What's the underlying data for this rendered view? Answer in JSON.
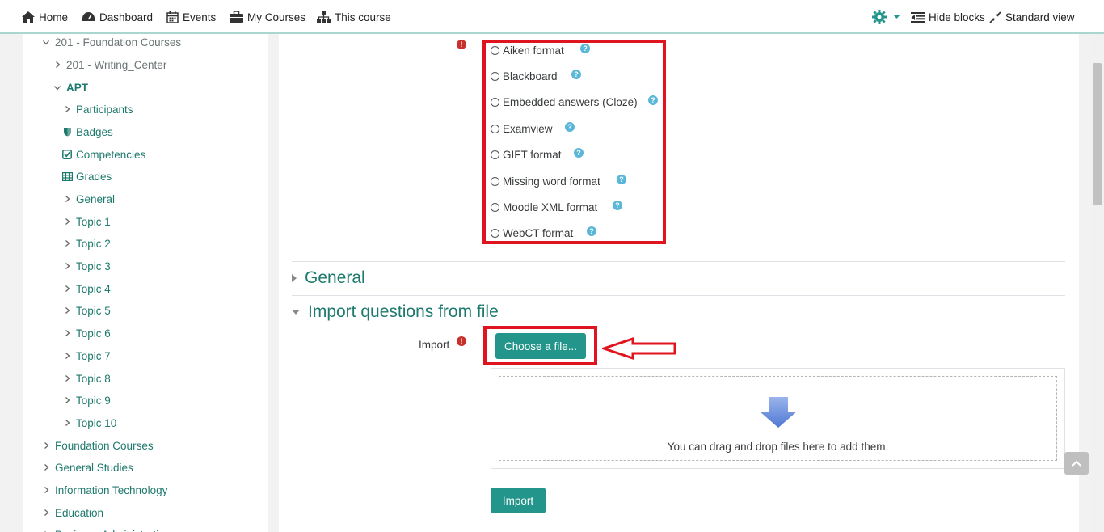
{
  "navbar": {
    "home": "Home",
    "dashboard": "Dashboard",
    "events": "Events",
    "my_courses": "My Courses",
    "this_course": "This course",
    "hide_blocks": "Hide blocks",
    "standard_view": "Standard view"
  },
  "sidebar": {
    "items": [
      {
        "label": "201 - Foundation Courses",
        "icon": "chevron-down"
      },
      {
        "label": "201 - Writing_Center",
        "icon": "chevron-right"
      },
      {
        "label": "APT",
        "icon": "chevron-down"
      },
      {
        "label": "Participants",
        "icon": "chevron-right"
      },
      {
        "label": "Badges",
        "icon": "shield"
      },
      {
        "label": "Competencies",
        "icon": "check-square"
      },
      {
        "label": "Grades",
        "icon": "table"
      },
      {
        "label": "General",
        "icon": "chevron-right"
      },
      {
        "label": "Topic 1",
        "icon": "chevron-right"
      },
      {
        "label": "Topic 2",
        "icon": "chevron-right"
      },
      {
        "label": "Topic 3",
        "icon": "chevron-right"
      },
      {
        "label": "Topic 4",
        "icon": "chevron-right"
      },
      {
        "label": "Topic 5",
        "icon": "chevron-right"
      },
      {
        "label": "Topic 6",
        "icon": "chevron-right"
      },
      {
        "label": "Topic 7",
        "icon": "chevron-right"
      },
      {
        "label": "Topic 8",
        "icon": "chevron-right"
      },
      {
        "label": "Topic 9",
        "icon": "chevron-right"
      },
      {
        "label": "Topic 10",
        "icon": "chevron-right"
      },
      {
        "label": "Foundation Courses",
        "icon": "chevron-right"
      },
      {
        "label": "General Studies",
        "icon": "chevron-right"
      },
      {
        "label": "Information Technology",
        "icon": "chevron-right"
      },
      {
        "label": "Education",
        "icon": "chevron-right"
      },
      {
        "label": "Business Administration",
        "icon": "chevron-right"
      }
    ]
  },
  "formats": [
    {
      "label": "Aiken format"
    },
    {
      "label": "Blackboard"
    },
    {
      "label": "Embedded answers (Cloze)"
    },
    {
      "label": "Examview"
    },
    {
      "label": "GIFT format"
    },
    {
      "label": "Missing word format"
    },
    {
      "label": "Moodle XML format"
    },
    {
      "label": "WebCT format"
    }
  ],
  "sections": {
    "general": "General",
    "import_from_file": "Import questions from file"
  },
  "import": {
    "label": "Import",
    "choose_file": "Choose a file...",
    "drop_hint": "You can drag and drop files here to add them.",
    "submit": "Import"
  },
  "colors": {
    "accent": "#23958a",
    "link": "#1f7a6e",
    "highlight": "#e0141e"
  }
}
